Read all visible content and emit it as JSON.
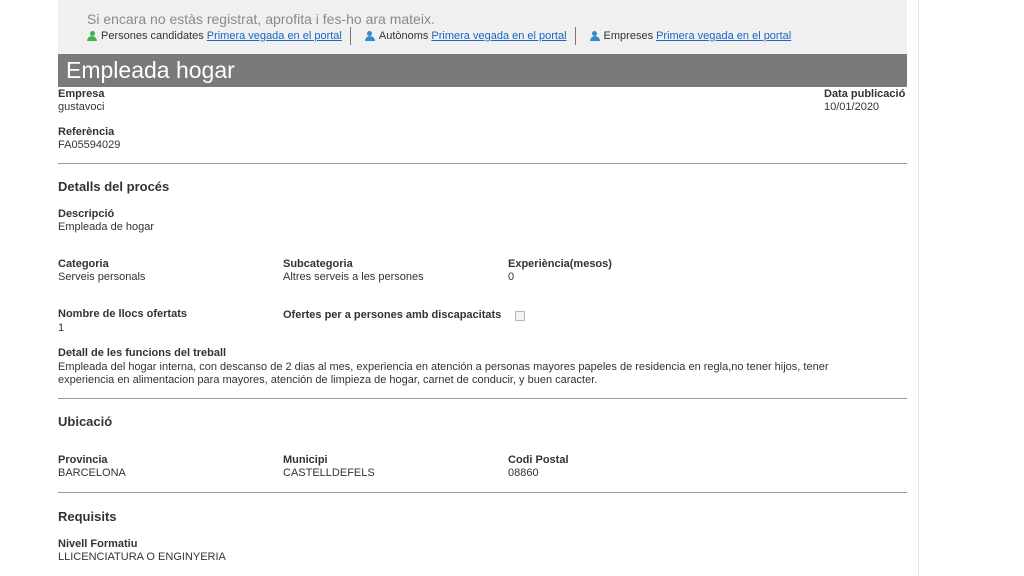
{
  "banner": {
    "message": "Si encara no estàs registrat, aprofita i fes-ho ara mateix.",
    "links": [
      {
        "label": "Persones candidates",
        "link": "Primera vegada en el portal",
        "icon": "person-icon",
        "color": "#3cb44b"
      },
      {
        "label": "Autònoms",
        "link": "Primera vegada en el portal",
        "icon": "person-icon",
        "color": "#2e8bcf"
      },
      {
        "label": "Empreses",
        "link": "Primera vegada en el portal",
        "icon": "person-icon",
        "color": "#2e8bcf"
      }
    ]
  },
  "page_title": "Empleada hogar",
  "header": {
    "empresa_label": "Empresa",
    "empresa_value": "gustavoci",
    "data_label": "Data publicació",
    "data_value": "10/01/2020",
    "referencia_label": "Referència",
    "referencia_value": "FA05594029"
  },
  "details": {
    "section_title": "Detalls del procés",
    "descripcio_label": "Descripció",
    "descripcio_value": "Empleada de hogar",
    "categoria_label": "Categoria",
    "categoria_value": "Serveis personals",
    "subcategoria_label": "Subcategoria",
    "subcategoria_value": "Altres serveis a les persones",
    "experiencia_label": "Experiència(mesos)",
    "experiencia_value": "0",
    "llocs_label": "Nombre de llocs ofertats",
    "llocs_value": "1",
    "discapacitats_label": "Ofertes per a persones amb discapacitats",
    "discapacitats_checked": false,
    "funcions_label": "Detall de les funcions del treball",
    "funcions_value": "Empleada del hogar interna, con descanso de 2 dias al mes, experiencia en atención a personas mayores papeles de residencia en regla,no tener hijos, tener experiencia en alimentacion para mayores, atención de limpieza de hogar, carnet de conducir, y buen caracter."
  },
  "ubicacio": {
    "section_title": "Ubicació",
    "provincia_label": "Provincia",
    "provincia_value": "BARCELONA",
    "municipi_label": "Municipi",
    "municipi_value": "CASTELLDEFELS",
    "cp_label": "Codi Postal",
    "cp_value": "08860"
  },
  "requisits": {
    "section_title": "Requisits",
    "nivell_label": "Nivell Formatiu",
    "nivell_value": "LLICENCIATURA O ENGINYERIA"
  },
  "colors": {
    "title_bar": "#7a7a7a",
    "banner_bg": "#f0f0f0",
    "link": "#1a66c2"
  }
}
